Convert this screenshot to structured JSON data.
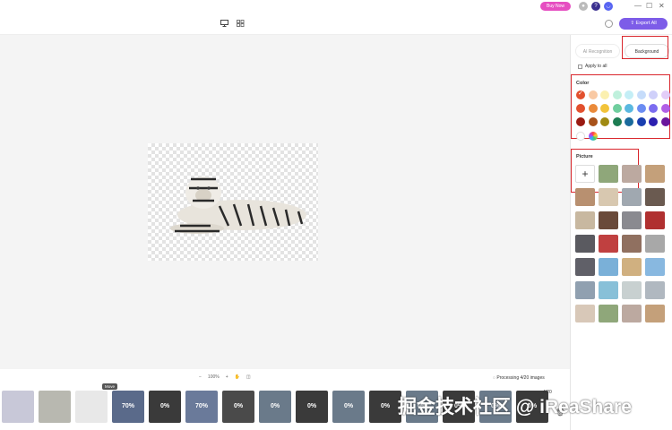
{
  "topbar": {
    "buy_label": "Buy Now",
    "help_icon": "question-icon",
    "account_icon": "user-icon"
  },
  "toolbar": {
    "export_label": "Export All",
    "views": [
      "monitor-icon",
      "grid-icon"
    ]
  },
  "panel": {
    "tabs": [
      "AI Recognition",
      "Background"
    ],
    "active_tab": "Background",
    "apply_all_label": "Apply to all",
    "color_label": "Color",
    "picture_label": "Picture",
    "colors": [
      [
        "#f8c6b4",
        "#f9c9a4",
        "#fbf0b0",
        "#bff0dc",
        "#c4eef6",
        "#c6dcfa",
        "#cfd0fa",
        "#e3cdf8"
      ],
      [
        "#e2502e",
        "#ea8a3a",
        "#f2c33a",
        "#6fce9e",
        "#5ab8e0",
        "#6b8cf2",
        "#7b6cf0",
        "#b060e6"
      ],
      [
        "#9a1a12",
        "#a8521a",
        "#a08a12",
        "#1c7c52",
        "#1a6a9c",
        "#1a3fb0",
        "#2b1fb0",
        "#6a169c"
      ]
    ],
    "extra_colors": [
      "#ffffff",
      "multicolor"
    ],
    "accent": "#7d5ce8",
    "highlight": "#d9262c"
  },
  "bottom": {
    "zoom_minus": "−",
    "zoom_value": "100%",
    "zoom_plus": "+",
    "processing_text": "Processing 4/20 images",
    "page_count": "4/20"
  },
  "strip": {
    "move_label": "Move",
    "items": [
      "",
      "",
      "",
      "70%",
      "0%",
      "70%",
      "0%",
      "0%",
      "0%",
      "0%",
      "0%",
      "0%",
      "0%",
      "0%",
      "0%"
    ]
  },
  "watermark": "掘金技术社区 @ iReaShare"
}
